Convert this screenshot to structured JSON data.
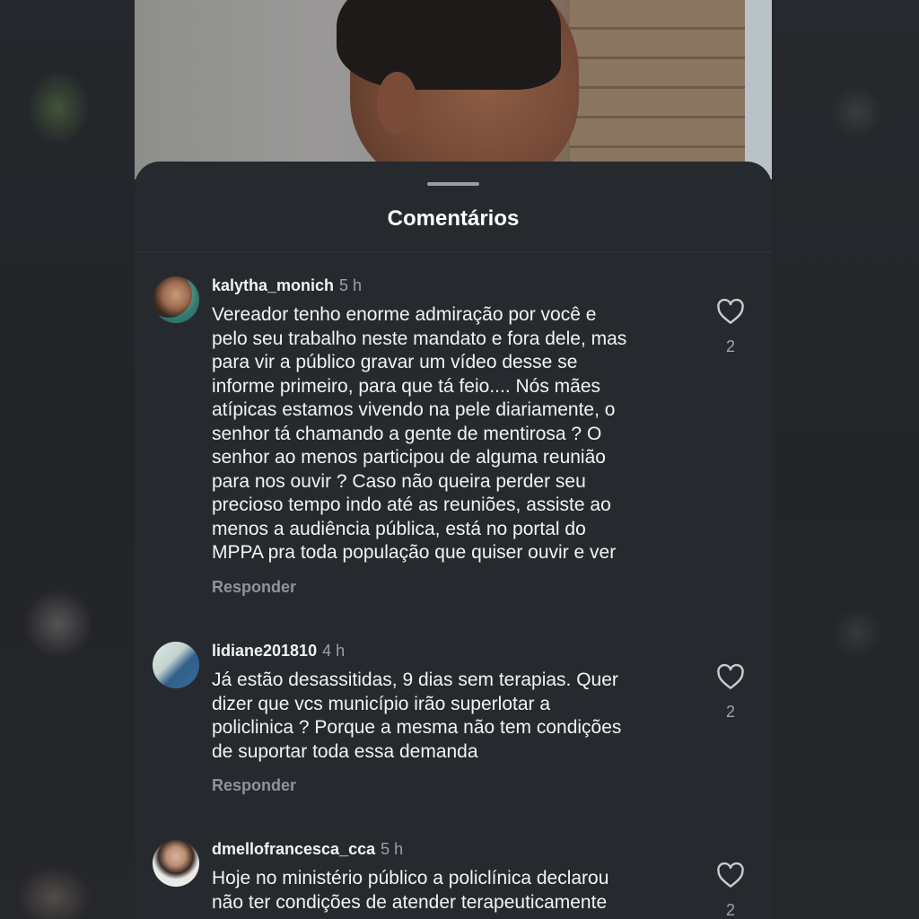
{
  "sheet": {
    "title": "Comentários"
  },
  "comments": [
    {
      "username": "kalytha_monich",
      "time": "5 h",
      "lines": [
        "Vereador tenho enorme admiração por você e",
        "pelo seu trabalho neste mandato e fora dele, mas",
        "para vir a público gravar um vídeo desse se",
        "informe primeiro, para que tá feio.... Nós mães",
        "atípicas estamos vivendo na pele diariamente, o",
        "senhor tá chamando a gente de mentirosa ? O",
        "senhor ao menos participou de alguma reunião",
        "para nos ouvir ? Caso não queira perder seu",
        "precioso tempo indo até as reuniões, assiste ao",
        "menos a audiência pública, está no portal do",
        "MPPA pra toda população que quiser ouvir e ver"
      ],
      "reply_label": "Responder",
      "likes": "2"
    },
    {
      "username": "lidiane201810",
      "time": "4 h",
      "lines": [
        "Já estão desassitidas, 9 dias sem terapias. Quer",
        "dizer que vcs município irão superlotar a",
        "policlinica ? Porque a mesma não tem condições",
        "de suportar toda essa demanda"
      ],
      "reply_label": "Responder",
      "likes": "2"
    },
    {
      "username": "dmellofrancesca_cca",
      "time": "5 h",
      "lines": [
        "Hoje no ministério público a policlínica declarou",
        "não ter condições de atender terapeuticamente"
      ],
      "reply_label": "",
      "likes": "2"
    }
  ],
  "icons": {
    "like": "heart-outline-icon"
  },
  "colors": {
    "sheet_bg": "#262a2f",
    "muted_text": "#8e949a"
  }
}
